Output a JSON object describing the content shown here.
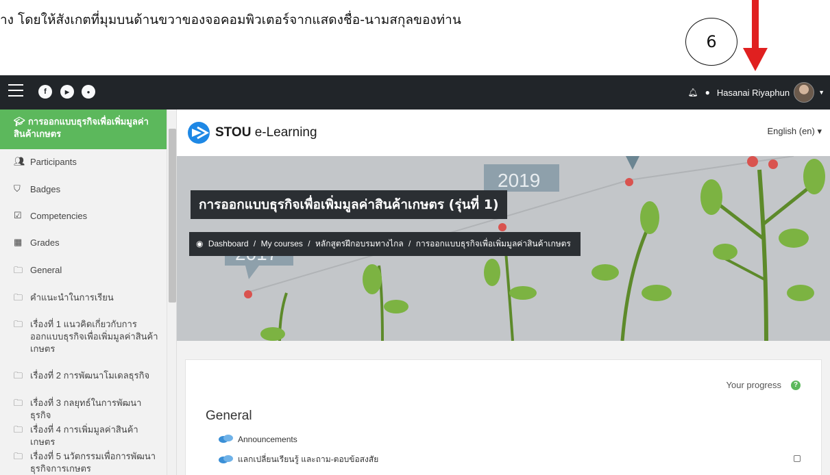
{
  "instruction": {
    "text": "าง โดยให้สังเกตที่มุมบนด้านขวาของจอคอมพิวเตอร์จากแสดงชื่อ-นามสกุลของท่าน",
    "step_number": "6"
  },
  "navbar": {
    "social": [
      "f",
      "▶",
      "●"
    ],
    "user_name": "Hasanai Riyaphun"
  },
  "sidebar": {
    "active_course": "การออกแบบธุรกิจเพื่อเพิ่มมูลค่าสินค้าเกษตร",
    "items": [
      {
        "icon": "users-icon",
        "label": "Participants"
      },
      {
        "icon": "shield-icon",
        "label": "Badges"
      },
      {
        "icon": "checkbox-icon",
        "label": "Competencies"
      },
      {
        "icon": "table-icon",
        "label": "Grades"
      },
      {
        "icon": "folder-icon",
        "label": "General"
      },
      {
        "icon": "folder-icon",
        "label": "คำแนะนำในการเรียน"
      },
      {
        "icon": "folder-icon",
        "label": "เรื่องที่ 1 แนวคิดเกี่ยวกับการออกแบบธุรกิจเพื่อเพิ่มมูลค่าสินค้าเกษตร"
      },
      {
        "icon": "folder-icon",
        "label": "เรื่องที่ 2 การพัฒนาโมเดลธุรกิจ"
      },
      {
        "icon": "folder-icon",
        "label": "เรื่องที่ 3 กลยุทธ์ในการพัฒนาธุรกิจ"
      },
      {
        "icon": "folder-icon",
        "label": "เรื่องที่ 4 การเพิ่มมูลค่าสินค้าเกษตร"
      },
      {
        "icon": "folder-icon",
        "label": "เรื่องที่ 5 นวัตกรรมเพื่อการพัฒนาธุรกิจการเกษตร"
      }
    ]
  },
  "brand": {
    "logo_bold": "STOU",
    "logo_rest": " e-Learning",
    "language": "English (en)"
  },
  "hero": {
    "course_title": "การออกแบบธุรกิจเพื่อเพิ่มมูลค่าสินค้าเกษตร (รุ่นที่ 1)",
    "breadcrumb": [
      "Dashboard",
      "My courses",
      "หลักสูตรฝึกอบรมทางไกล",
      "การออกแบบธุรกิจเพื่อเพิ่มมูลค่าสินค้าเกษตร"
    ],
    "year_signs": [
      "2019",
      "2017"
    ]
  },
  "content": {
    "progress_label": "Your progress",
    "section_title": "General",
    "activities": [
      {
        "label": "Announcements",
        "has_checkbox": false
      },
      {
        "label": "แลกเปลี่ยนเรียนรู้ และถาม-ตอบข้อสงสัย",
        "has_checkbox": true
      }
    ]
  },
  "colors": {
    "navbar": "#212529",
    "active_green": "#5cb85c",
    "arrow_red": "#e02020"
  }
}
